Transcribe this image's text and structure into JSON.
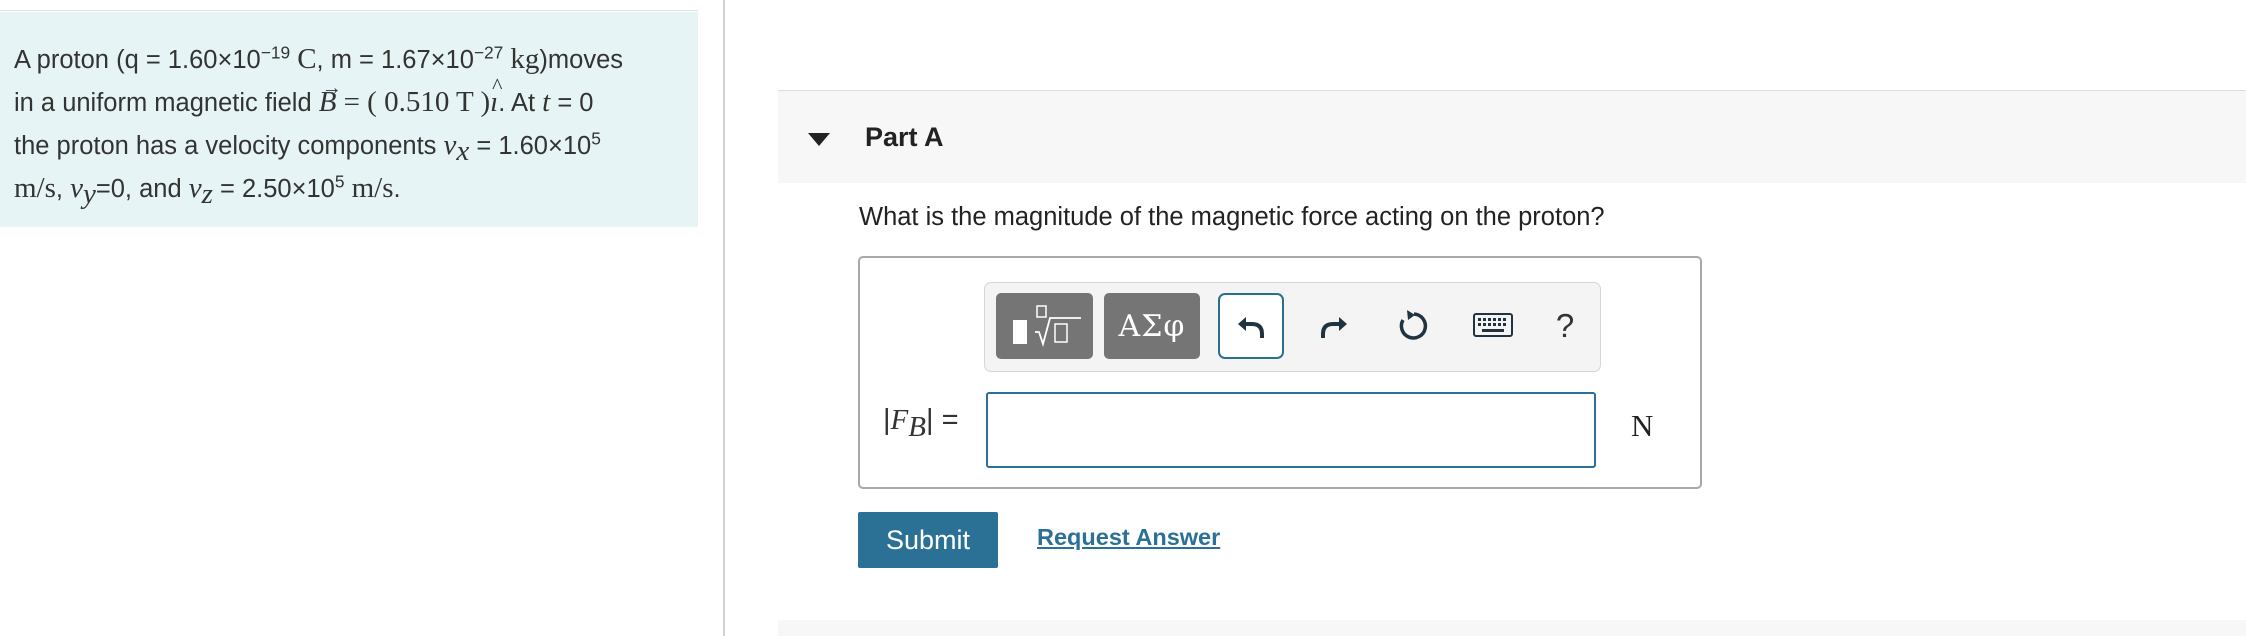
{
  "problem": {
    "p1": "A proton (q = 1.60×10",
    "q_exp": "−19",
    "q_unit": "C",
    "p2": ", m = 1.67×10",
    "m_exp": "−27",
    "m_unit": "kg",
    "p3": ")moves",
    "p4": "in a uniform magnetic field",
    "b_sym": "B",
    "b_val": "= ( 0.510 T )",
    "i_sym": "ı",
    "p5": ". At",
    "t_sym": "t",
    "p6": "= 0",
    "p7": "the proton has a velocity components",
    "vx_sym": "v",
    "vx_sub": "x",
    "p8": "= 1.60×10",
    "vx_exp": "5",
    "vx_unit": "m/s",
    "p9": ",",
    "vy_sym": "v",
    "vy_sub": "y",
    "p10": "=0, and",
    "vz_sym": "v",
    "vz_sub": "z",
    "p11": "= 2.50×10",
    "vz_exp": "5",
    "vz_unit": "m/s",
    "p12": "."
  },
  "part": {
    "title": "Part A",
    "question": "What is the magnitude of the magnetic force acting on the proton?"
  },
  "toolbar": {
    "symbols_label": "ΑΣφ",
    "help_label": "?",
    "icons": [
      "templates-icon",
      "undo-icon",
      "redo-icon",
      "reset-icon",
      "keyboard-icon"
    ]
  },
  "answer": {
    "label_open": "|",
    "label_sym": "F",
    "label_sub": "B",
    "label_close": "| =",
    "value": "",
    "unit": "N"
  },
  "actions": {
    "submit_label": "Submit",
    "request_label": "Request Answer"
  },
  "colors": {
    "problem_bg": "#e6f4f5",
    "accent": "#2b7095",
    "toolbar_gray": "#757575"
  }
}
